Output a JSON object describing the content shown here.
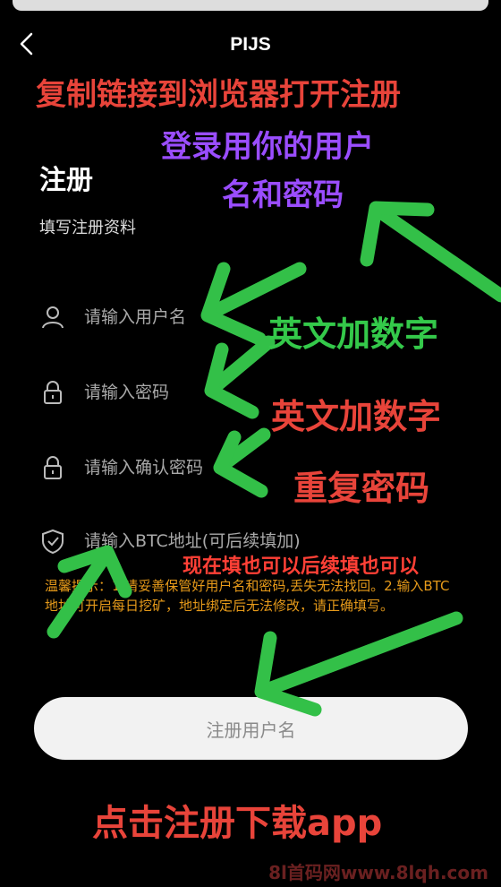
{
  "header": {
    "title": "PIJS"
  },
  "form": {
    "heading": "注册",
    "subtitle": "填写注册资料",
    "fields": [
      {
        "icon": "user-icon",
        "placeholder": "请输入用户名"
      },
      {
        "icon": "lock-icon",
        "placeholder": "请输入密码"
      },
      {
        "icon": "lock-icon",
        "placeholder": "请输入确认密码"
      },
      {
        "icon": "shield-check-icon",
        "placeholder": "请输入BTC地址(可后续填加)"
      }
    ],
    "notice": "温馨提示：1.请妥善保管好用户名和密码,丢失无法找回。2.输入BTC地址可开启每日挖矿，地址绑定后无法修改，请正确填写。",
    "submit_label": "注册用户名"
  },
  "annotations": {
    "copy_link": "复制链接到浏览器打开注册",
    "login_hint_line1": "登录用你的用户",
    "login_hint_line2": "名和密码",
    "username_hint": "英文加数字",
    "password_hint": "英文加数字",
    "repeat_password_hint": "重复密码",
    "btc_hint": "现在填也可以后续填也可以",
    "click_hint": "点击注册下载app"
  },
  "watermark": "8l首码网www.8lqh.com",
  "colors": {
    "background": "#000000",
    "annotation_red": "#e8443a",
    "annotation_purple": "#9a4dff",
    "annotation_green": "#34c94a",
    "notice_orange": "#e69a1a",
    "button_bg": "#f2f2f2"
  }
}
